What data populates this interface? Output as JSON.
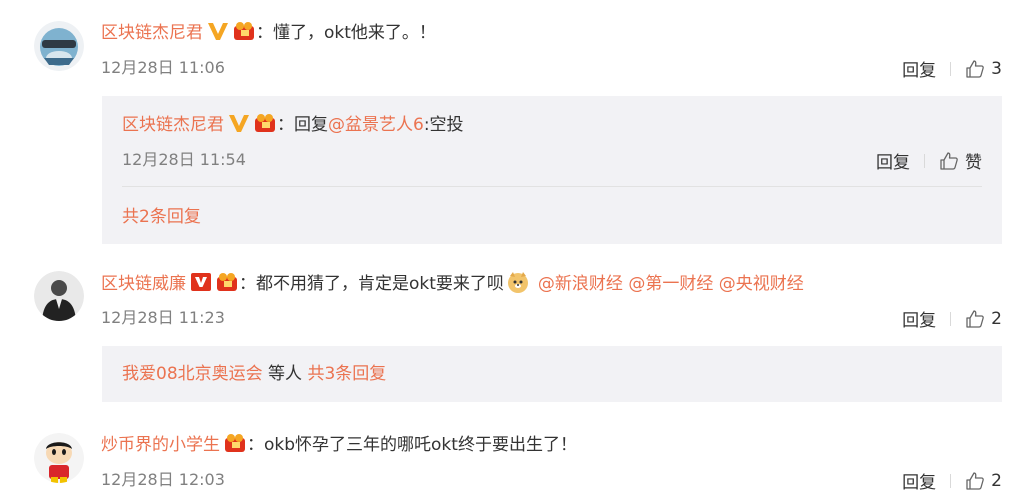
{
  "comments": [
    {
      "user": "区块链杰尼君",
      "sep": "：",
      "text": "懂了，okt他来了。！",
      "time": "12月28日 11:06",
      "reply_label": "回复",
      "like_count": "3",
      "sub_reply": {
        "user": "区块链杰尼君",
        "sep": "：",
        "prefix": "回复",
        "mention": "@盆景艺人6",
        "text": ":空投",
        "time": "12月28日 11:54",
        "reply_label": "回复",
        "like_label": "赞"
      },
      "more_replies": "共2条回复"
    },
    {
      "user": "区块链威廉",
      "sep": "：",
      "text": "都不用猜了，肯定是okt要来了呗",
      "mentions": [
        "@新浪财经",
        "@第一财经",
        "@央视财经"
      ],
      "time": "12月28日 11:23",
      "reply_label": "回复",
      "like_count": "2",
      "summary": {
        "user": "我爱08北京奥运会",
        "middle": " 等人 ",
        "count": "共3条回复"
      }
    },
    {
      "user": "炒币界的小学生",
      "sep": "：",
      "text": "okb怀孕了三年的哪吒okt终于要出生了！",
      "time": "12月28日 12:03",
      "reply_label": "回复",
      "like_count": "2"
    }
  ],
  "colors": {
    "accent": "#eb7350",
    "gold": "#f5a623",
    "red_badge": "#e0321c",
    "sub_bg": "#f2f2f5"
  }
}
